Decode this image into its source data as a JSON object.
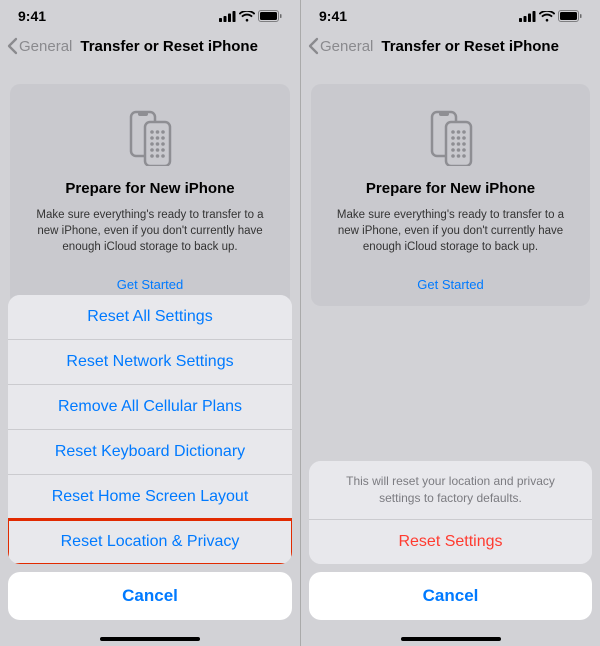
{
  "status": {
    "time": "9:41"
  },
  "nav": {
    "back": "General",
    "title": "Transfer or Reset iPhone"
  },
  "card": {
    "title": "Prepare for New iPhone",
    "body": "Make sure everything's ready to transfer to a new iPhone, even if you don't currently have enough iCloud storage to back up.",
    "cta": "Get Started"
  },
  "left_sheet": {
    "items": [
      {
        "label": "Reset All Settings"
      },
      {
        "label": "Reset Network Settings"
      },
      {
        "label": "Remove All Cellular Plans"
      },
      {
        "label": "Reset Keyboard Dictionary"
      },
      {
        "label": "Reset Home Screen Layout"
      },
      {
        "label": "Reset Location & Privacy"
      }
    ],
    "cancel": "Cancel"
  },
  "right_sheet": {
    "message": "This will reset your location and privacy settings to factory defaults.",
    "confirm": "Reset Settings",
    "cancel": "Cancel"
  }
}
